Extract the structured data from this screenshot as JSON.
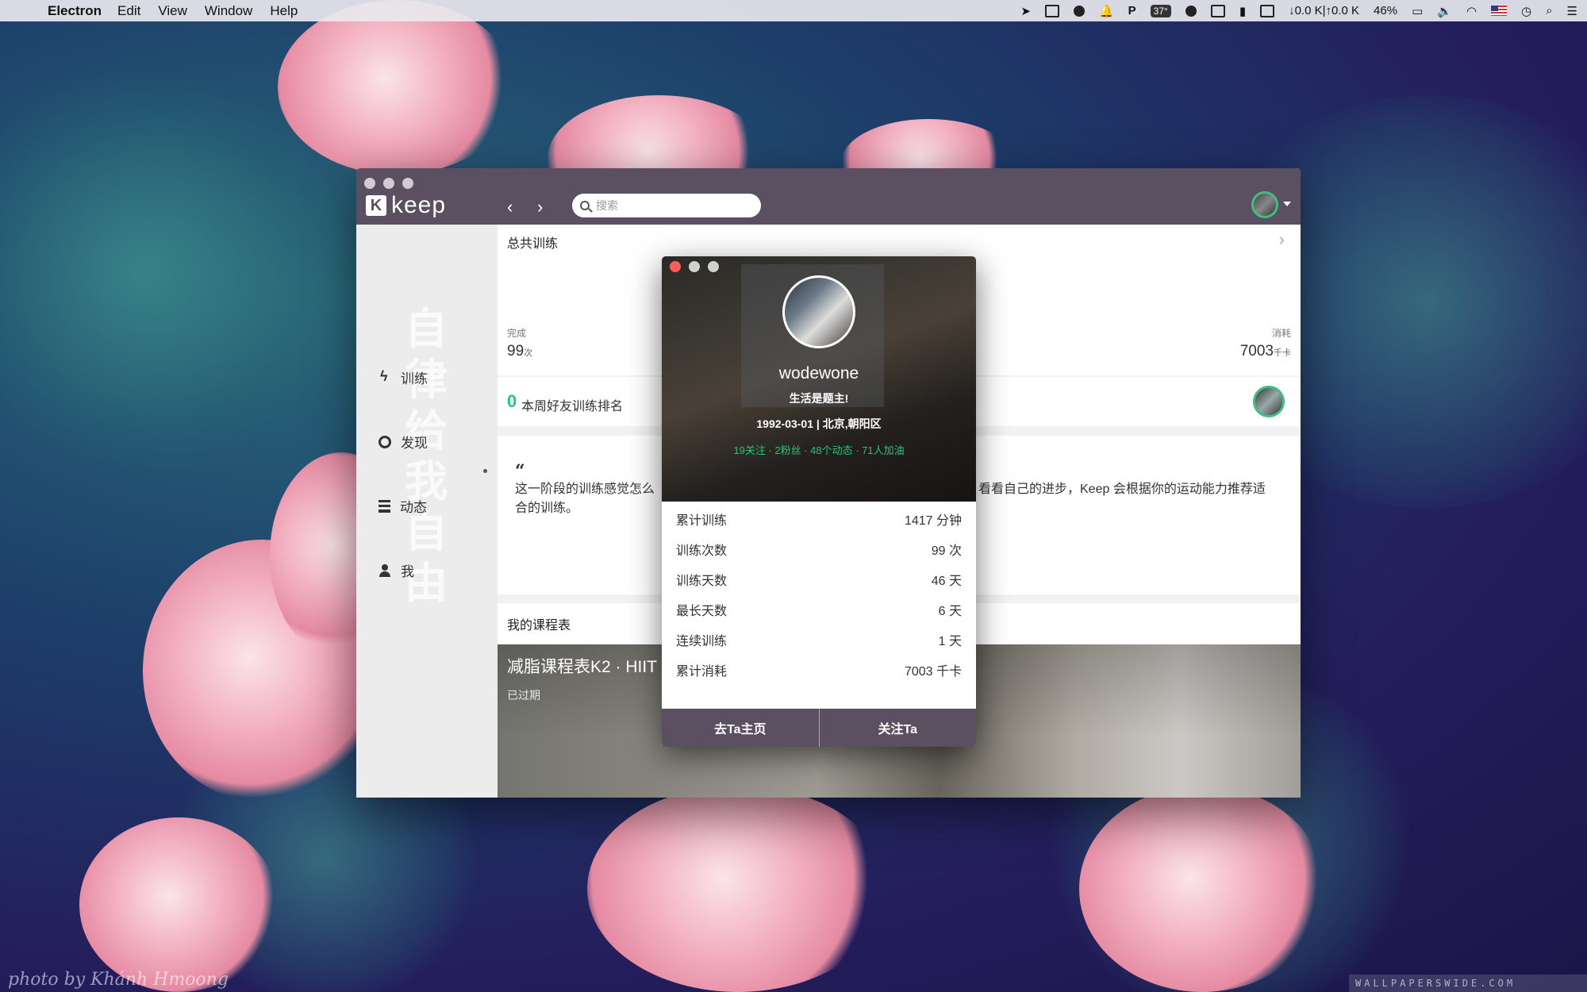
{
  "menubar": {
    "app_name": "Electron",
    "items": [
      "Edit",
      "View",
      "Window",
      "Help"
    ],
    "temperature": "37°",
    "network": "↓0.0 K|↑0.0 K",
    "battery": "46%"
  },
  "wallpaper": {
    "photo_credit": "photo by Khánh Hmoong",
    "site_credit": "WALLPAPERSWIDE.COM"
  },
  "app": {
    "logo_text": "keep",
    "logo_letter": "K",
    "search_placeholder": "搜索",
    "sidebar": {
      "watermark": "自律给我自由",
      "items": [
        {
          "label": "训练",
          "icon": "bolt-icon"
        },
        {
          "label": "发现",
          "icon": "ring-icon"
        },
        {
          "label": "动态",
          "icon": "list-icon"
        },
        {
          "label": "我",
          "icon": "user-icon"
        }
      ]
    },
    "total": {
      "title": "总共训练",
      "completed_label": "完成",
      "completed_value": "99",
      "completed_unit": "次",
      "consumed_label": "消耗",
      "consumed_value": "7003",
      "consumed_unit": "千卡"
    },
    "rank": {
      "number": "0",
      "label": "本周好友训练排名"
    },
    "quote": {
      "mark": "“",
      "text_left": "这一阶段的训练感觉怎么合的训练。",
      "text_right": "看看自己的进步，Keep 会根据你的运动能力推荐适"
    },
    "plan": {
      "title": "我的课程表",
      "name": "减脂课程表K2 · HIIT",
      "status": "已过期"
    }
  },
  "popup": {
    "username": "wodewone",
    "motto": "生活是题主!",
    "info": "1992-03-01 | 北京,朝阳区",
    "social": "19关注 · 2粉丝 · 48个动态 · 71人加油",
    "stats": [
      {
        "label": "累计训练",
        "value": "1417 分钟"
      },
      {
        "label": "训练次数",
        "value": "99 次"
      },
      {
        "label": "训练天数",
        "value": "46 天"
      },
      {
        "label": "最长天数",
        "value": "6 天"
      },
      {
        "label": "连续训练",
        "value": "1 天"
      },
      {
        "label": "累计消耗",
        "value": "7003 千卡"
      }
    ],
    "actions": {
      "homepage": "去Ta主页",
      "follow": "关注Ta"
    }
  }
}
